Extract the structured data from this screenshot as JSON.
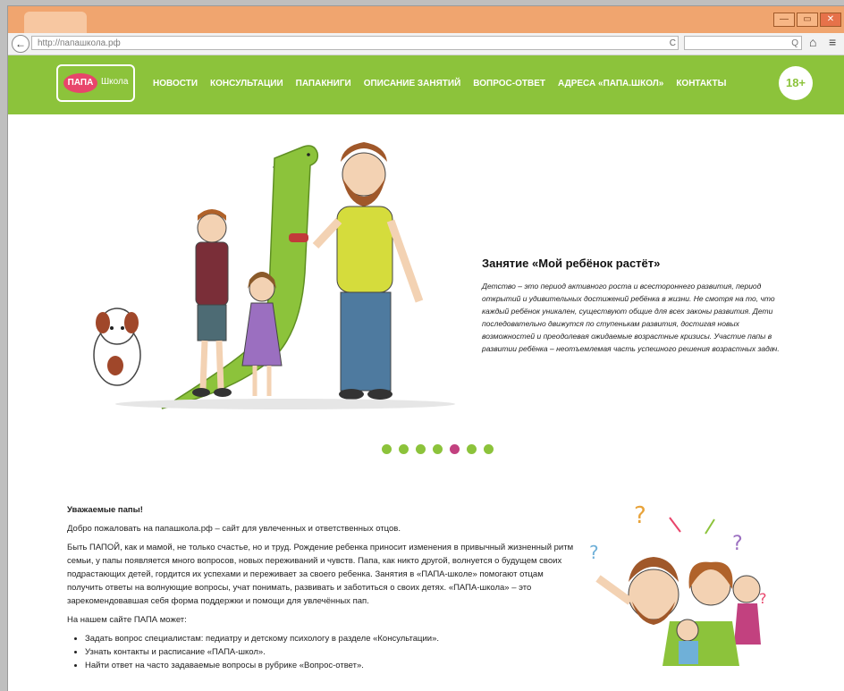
{
  "browser": {
    "url": "http://папашкола.рф",
    "back_glyph": "←",
    "reload_glyph": "C",
    "search_glyph": "Q",
    "home_glyph": "⌂",
    "menu_glyph": "≡",
    "window_buttons": [
      "—",
      "▭",
      "✕"
    ]
  },
  "site": {
    "logo": {
      "papa": "ПАПА",
      "shkola": "Школа"
    },
    "nav": [
      "НОВОСТИ",
      "КОНСУЛЬТАЦИИ",
      "ПАПАКНИГИ",
      "ОПИСАНИЕ ЗАНЯТИЙ",
      "ВОПРОС-ОТВЕТ",
      "АДРЕСА «ПАПА.ШКОЛ»",
      "КОНТАКТЫ"
    ],
    "age_badge": "18+",
    "accent": "#8cc33b",
    "dot_active_color": "#c2417f"
  },
  "slide": {
    "title": "Занятие «Мой ребёнок растёт»",
    "text": "Детство – это период активного роста и всестороннего развития, период открытий и удивительных достижений ребёнка в жизни. Не смотря на то, что каждый ребёнок уникален, существуют общие для всех законы развития. Дети последовательно движутся по ступенькам развития, достигая новых возможностей и преодолевая ожидаемые возрастные кризисы. Участие папы в развитии ребёнка – неотъемлемая часть успешного решения возрастных задач.",
    "dots_total": 7,
    "active_dot": 5
  },
  "content": {
    "greeting": "Уважаемые папы!",
    "welcome": "Добро пожаловать на папашкола.рф – сайт для увлеченных и ответственных отцов.",
    "body": "Быть ПАПОЙ, как и мамой, не только счастье, но и труд. Рождение ребенка приносит изменения в привычный жизненный ритм семьи, у папы появляется много вопросов, новых переживаний и чувств. Папа, как никто другой, волнуется о будущем своих подрастающих детей, гордится их успехами и переживает за своего ребенка. Занятия в «ПАПА-школе» помогают отцам получить ответы на волнующие вопросы, учат понимать, развивать и заботиться о своих детях. «ПАПА-школа» – это зарекомендовавшая себя форма поддержки и помощи для увлечённых пап.",
    "list_intro": "На нашем сайте ПАПА может:",
    "list": [
      "Задать вопрос специалистам: педиатру и детскому психологу в разделе «Консультации».",
      "Узнать контакты и расписание «ПАПА-школ».",
      "Найти ответ на часто задаваемые вопросы в рубрике «Вопрос-ответ»."
    ]
  }
}
